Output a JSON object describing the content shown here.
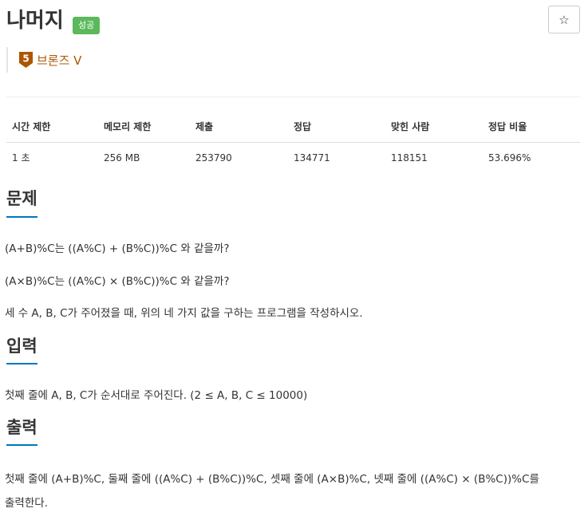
{
  "problem": {
    "title": "나머지",
    "status_badge": "성공",
    "star_icon": "☆",
    "tier_number": "5",
    "tier_label": "브론즈 V"
  },
  "stats": {
    "headers": [
      "시간 제한",
      "메모리 제한",
      "제출",
      "정답",
      "맞힌 사람",
      "정답 비율"
    ],
    "values": [
      "1 초",
      "256 MB",
      "253790",
      "134771",
      "118151",
      "53.696%"
    ]
  },
  "sections": {
    "description": {
      "heading": "문제",
      "lines": [
        "(A+B)%C는 ((A%C) + (B%C))%C 와 같을까?",
        "(A×B)%C는 ((A%C) × (B%C))%C 와 같을까?",
        "세 수 A, B, C가 주어졌을 때, 위의 네 가지 값을 구하는 프로그램을 작성하시오."
      ]
    },
    "input": {
      "heading": "입력",
      "lines": [
        "첫째 줄에 A, B, C가 순서대로 주어진다. (2 ≤ A, B, C ≤ 10000)"
      ]
    },
    "output": {
      "heading": "출력",
      "lines": [
        "첫째 줄에 (A+B)%C, 둘째 줄에 ((A%C) + (B%C))%C, 셋째 줄에 (A×B)%C, 넷째 줄에 ((A%C) × (B%C))%C를",
        "출력한다."
      ]
    }
  },
  "colors": {
    "badge_success": "#5cb85c",
    "tier_bronze": "#ad5600",
    "section_underline": "#0076c0"
  }
}
